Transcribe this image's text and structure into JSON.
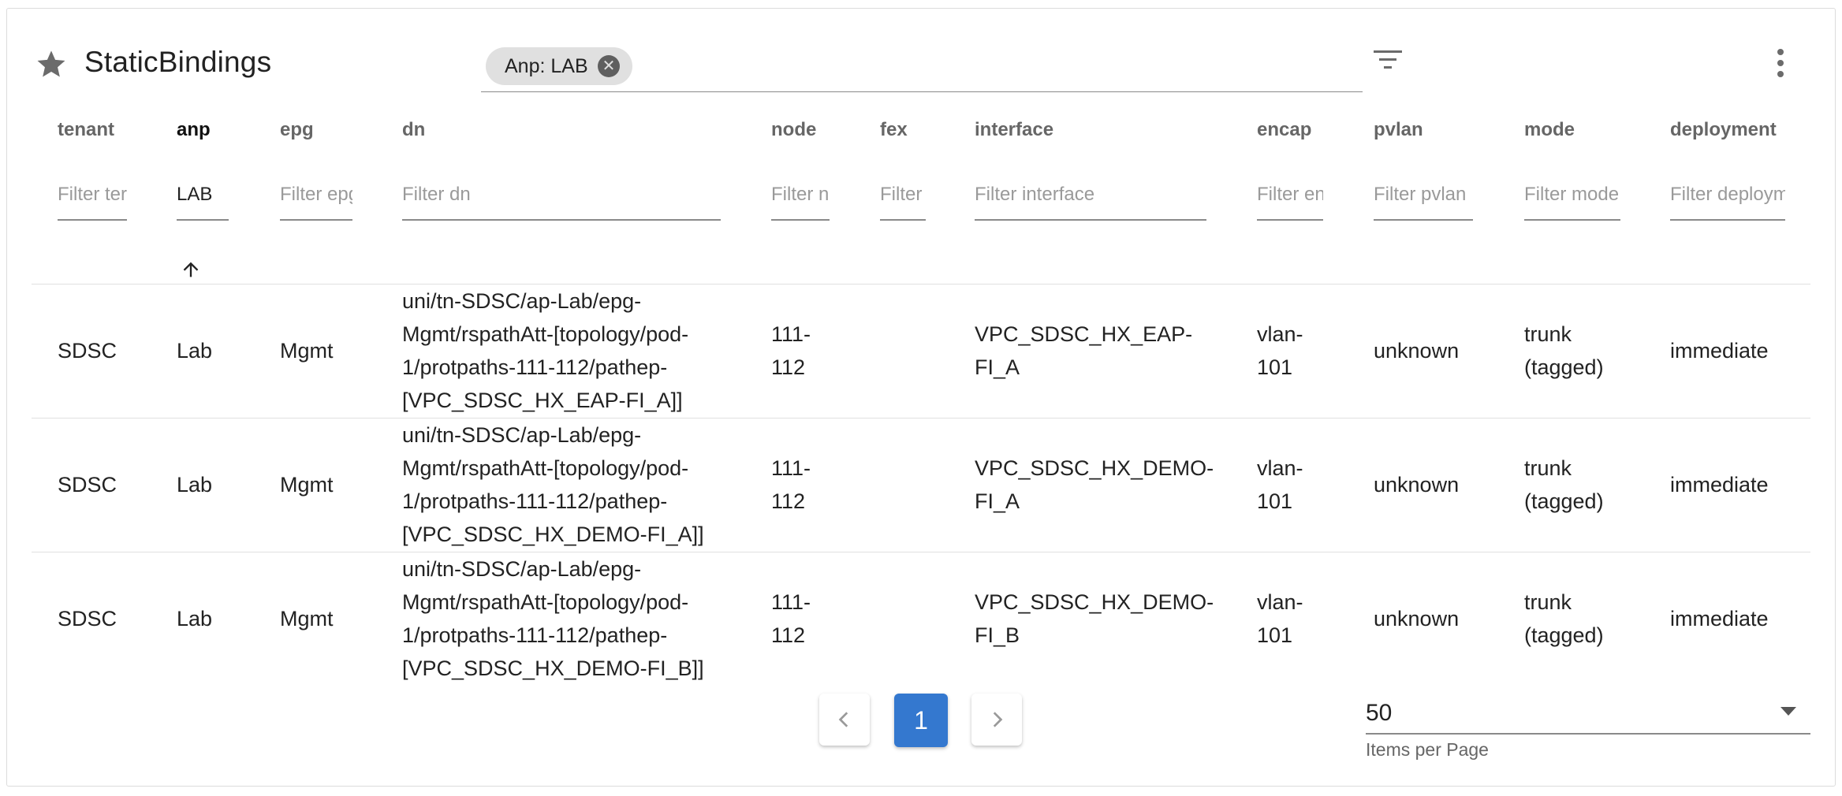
{
  "header": {
    "title": "StaticBindings",
    "chip_label": "Anp: LAB",
    "chip_close": "✕"
  },
  "columns": [
    {
      "key": "tenant",
      "label": "tenant",
      "placeholder": "Filter ter",
      "value": ""
    },
    {
      "key": "anp",
      "label": "anp",
      "placeholder": "",
      "value": "LAB"
    },
    {
      "key": "epg",
      "label": "epg",
      "placeholder": "Filter epg",
      "value": ""
    },
    {
      "key": "dn",
      "label": "dn",
      "placeholder": "Filter dn",
      "value": ""
    },
    {
      "key": "node",
      "label": "node",
      "placeholder": "Filter n",
      "value": ""
    },
    {
      "key": "fex",
      "label": "fex",
      "placeholder": "Filter",
      "value": ""
    },
    {
      "key": "interface",
      "label": "interface",
      "placeholder": "Filter interface",
      "value": ""
    },
    {
      "key": "encap",
      "label": "encap",
      "placeholder": "Filter en",
      "value": ""
    },
    {
      "key": "pvlan",
      "label": "pvlan",
      "placeholder": "Filter pvlan",
      "value": ""
    },
    {
      "key": "mode",
      "label": "mode",
      "placeholder": "Filter mode",
      "value": ""
    },
    {
      "key": "deployment",
      "label": "deployment",
      "placeholder": "Filter deploym",
      "value": ""
    }
  ],
  "rows": [
    {
      "tenant": "SDSC",
      "anp": "Lab",
      "epg": "Mgmt",
      "dn": [
        "uni/tn-SDSC/ap-Lab/epg-",
        "Mgmt/rspathAtt-[topology/pod-",
        "1/protpaths-111-112/pathep-",
        "[VPC_SDSC_HX_EAP-FI_A]]"
      ],
      "node": [
        "111-",
        "112"
      ],
      "fex": "",
      "interface": [
        "VPC_SDSC_HX_EAP-",
        "FI_A"
      ],
      "encap": [
        "vlan-",
        "101"
      ],
      "pvlan": "unknown",
      "mode": [
        "trunk",
        "(tagged)"
      ],
      "deployment": "immediate"
    },
    {
      "tenant": "SDSC",
      "anp": "Lab",
      "epg": "Mgmt",
      "dn": [
        "uni/tn-SDSC/ap-Lab/epg-",
        "Mgmt/rspathAtt-[topology/pod-",
        "1/protpaths-111-112/pathep-",
        "[VPC_SDSC_HX_DEMO-FI_A]]"
      ],
      "node": [
        "111-",
        "112"
      ],
      "fex": "",
      "interface": [
        "VPC_SDSC_HX_DEMO-",
        "FI_A"
      ],
      "encap": [
        "vlan-",
        "101"
      ],
      "pvlan": "unknown",
      "mode": [
        "trunk",
        "(tagged)"
      ],
      "deployment": "immediate"
    },
    {
      "tenant": "SDSC",
      "anp": "Lab",
      "epg": "Mgmt",
      "dn": [
        "uni/tn-SDSC/ap-Lab/epg-",
        "Mgmt/rspathAtt-[topology/pod-",
        "1/protpaths-111-112/pathep-",
        "[VPC_SDSC_HX_DEMO-FI_B]]"
      ],
      "node": [
        "111-",
        "112"
      ],
      "fex": "",
      "interface": [
        "VPC_SDSC_HX_DEMO-",
        "FI_B"
      ],
      "encap": [
        "vlan-",
        "101"
      ],
      "pvlan": "unknown",
      "mode": [
        "trunk",
        "(tagged)"
      ],
      "deployment": "immediate"
    }
  ],
  "pagination": {
    "current_page": "1",
    "prev_icon": "chevron-left",
    "next_icon": "chevron-right",
    "items_per_page": "50",
    "items_per_page_label": "Items per Page"
  },
  "colors": {
    "accent": "#3478cf",
    "chip_bg": "#e0e0e0",
    "divider": "#e0e0e0"
  }
}
